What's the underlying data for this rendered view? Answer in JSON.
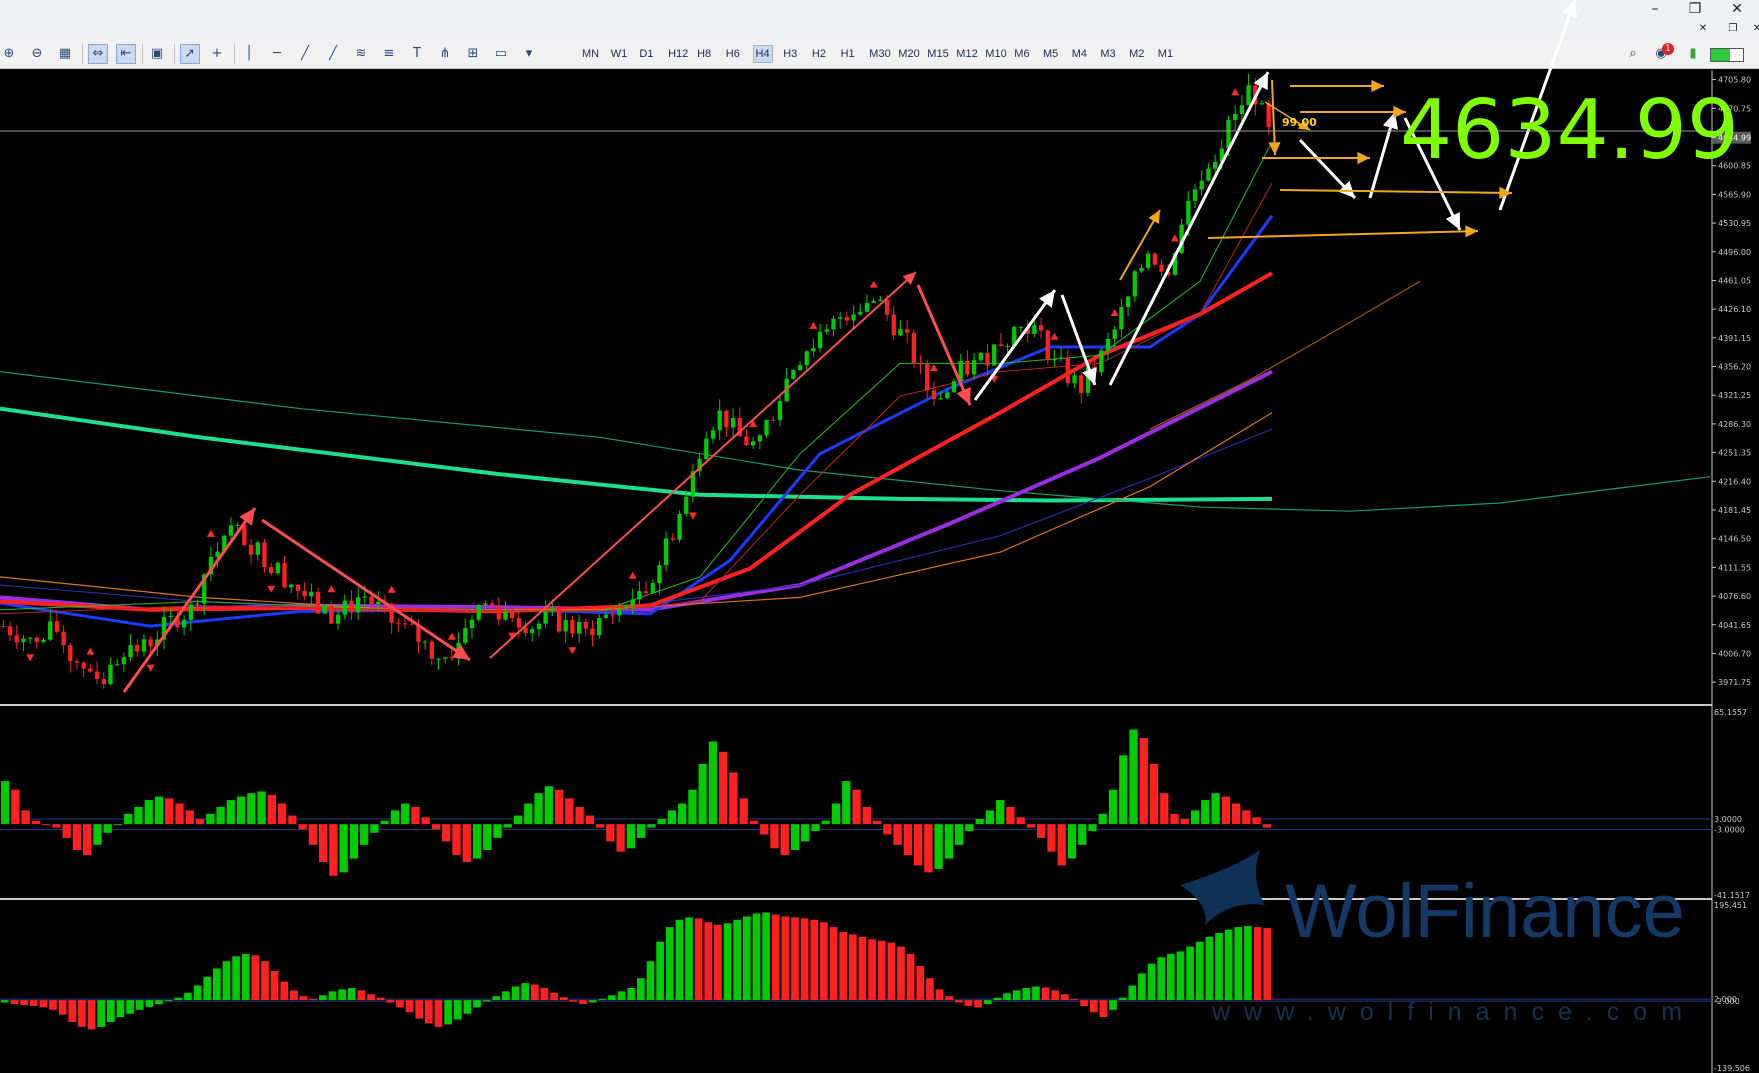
{
  "window": {
    "minimize": "–",
    "restore": "❐",
    "close": "✕"
  },
  "toolbar": {
    "timeframes": [
      "MN",
      "W1",
      "D1",
      "H12",
      "H8",
      "H6",
      "H4",
      "H3",
      "H2",
      "H1",
      "M30",
      "M20",
      "M15",
      "M12",
      "M10",
      "M6",
      "M5",
      "M4",
      "M3",
      "M2",
      "M1"
    ],
    "active_timeframe": "H4",
    "notification_badge": "1",
    "icons": [
      "zoom-in-icon",
      "zoom-out-icon",
      "grid-icon",
      "autoscroll-icon",
      "chart-shift-icon",
      "screenshot-icon",
      "cursor-icon",
      "crosshair-icon",
      "vertical-line-icon",
      "horizontal-line-icon",
      "trendline-icon",
      "ray-icon",
      "channel-icon",
      "fibonacci-icon",
      "text-icon",
      "andrews-icon",
      "gann-icon",
      "rectangle-icon",
      "shapes-icon"
    ]
  },
  "colors": {
    "background": "#000000",
    "bull": "#00cc00",
    "bear": "#ff2020",
    "price_label_big": "#7fff00",
    "ma_fast": "#ff2020",
    "ma_blue": "#1a3cff",
    "ma_purple": "#9a2fe0",
    "ma_green_long": "#1fe08a",
    "arrow_red": "#ff4c4c",
    "arrow_white": "#ffffff",
    "arrow_orange": "#f0a818",
    "watermark": "#123a66"
  },
  "chart_data": [
    {
      "type": "candlestick",
      "title": "",
      "current_price_label": "4634.99",
      "annotation_label": "99.00",
      "price_axis_ticks": [
        "4705.80",
        "4670.75",
        "4634.99",
        "4600.85",
        "4565.90",
        "4530.95",
        "4496.00",
        "4461.05",
        "4426.10",
        "4391.15",
        "4356.20",
        "4321.25",
        "4286.30",
        "4251.35",
        "4216.40",
        "4181.45",
        "4146.50",
        "4111.55",
        "4076.60",
        "4041.65",
        "4006.70",
        "3971.75"
      ],
      "ylim": [
        3950,
        4715
      ],
      "current_price": 4634.99,
      "close_path": [
        4040,
        4030,
        4015,
        4040,
        4000,
        3990,
        3975,
        4015,
        4010,
        4030,
        4050,
        4060,
        4120,
        4160,
        4150,
        4130,
        4110,
        4090,
        4070,
        4050,
        4060,
        4080,
        4060,
        4040,
        4030,
        4010,
        4000,
        4040,
        4070,
        4060,
        4050,
        4040,
        4050,
        4040,
        4030,
        4050,
        4060,
        4080,
        4100,
        4150,
        4200,
        4280,
        4300,
        4270,
        4260,
        4300,
        4350,
        4380,
        4390,
        4420,
        4430,
        4440,
        4410,
        4380,
        4330,
        4320,
        4350,
        4360,
        4380,
        4400,
        4410,
        4380,
        4350,
        4330,
        4360,
        4400,
        4450,
        4500,
        4470,
        4540,
        4590,
        4620,
        4660,
        4700,
        4640
      ],
      "annotations": [
        "4634.99",
        "99.00"
      ]
    },
    {
      "type": "bar",
      "title": "",
      "ylim": [
        -41.1517,
        65.1557
      ],
      "axis_ticks": [
        "65.1557",
        "3.0000",
        "-3.0000",
        "-41.1517"
      ],
      "levels": [
        3.0,
        -3.0
      ],
      "values": [
        25,
        20,
        8,
        2,
        0,
        -2,
        -8,
        -15,
        -18,
        -12,
        -5,
        0,
        6,
        10,
        14,
        16,
        15,
        12,
        8,
        3,
        6,
        10,
        14,
        16,
        18,
        19,
        17,
        12,
        5,
        -3,
        -12,
        -22,
        -30,
        -28,
        -20,
        -12,
        -5,
        2,
        8,
        12,
        10,
        4,
        -3,
        -10,
        -18,
        -22,
        -20,
        -15,
        -8,
        -2,
        5,
        12,
        18,
        22,
        20,
        15,
        10,
        5,
        -2,
        -10,
        -16,
        -14,
        -8,
        -2,
        3,
        8,
        12,
        20,
        35,
        48,
        42,
        30,
        15,
        2,
        -6,
        -14,
        -18,
        -15,
        -10,
        -4,
        2,
        12,
        25,
        20,
        10,
        2,
        -6,
        -12,
        -18,
        -24,
        -28,
        -26,
        -20,
        -12,
        -4,
        3,
        8,
        14,
        10,
        4,
        -2,
        -8,
        -16,
        -24,
        -20,
        -12,
        -4,
        6,
        20,
        40,
        55,
        50,
        35,
        18,
        6,
        3,
        8,
        14,
        18,
        16,
        12,
        8,
        4,
        -2
      ]
    },
    {
      "type": "bar",
      "title": "",
      "ylim": [
        -139.506,
        195.451
      ],
      "axis_ticks": [
        "195.451",
        "2.000",
        "-2.000",
        "-139.506"
      ],
      "levels": [
        2.0,
        -2.0
      ],
      "values": [
        -5,
        -8,
        -10,
        -12,
        -15,
        -20,
        -30,
        -45,
        -55,
        -60,
        -55,
        -45,
        -35,
        -28,
        -20,
        -14,
        -8,
        -2,
        5,
        15,
        30,
        48,
        65,
        80,
        90,
        95,
        92,
        80,
        60,
        38,
        20,
        8,
        2,
        10,
        18,
        22,
        25,
        20,
        12,
        5,
        -5,
        -15,
        -25,
        -38,
        -48,
        -55,
        -50,
        -40,
        -28,
        -15,
        -3,
        8,
        18,
        28,
        35,
        32,
        25,
        15,
        6,
        -3,
        -8,
        -5,
        2,
        10,
        18,
        25,
        45,
        80,
        120,
        150,
        165,
        170,
        168,
        160,
        155,
        158,
        165,
        172,
        178,
        180,
        176,
        172,
        170,
        168,
        165,
        160,
        150,
        140,
        135,
        130,
        125,
        122,
        118,
        110,
        95,
        70,
        45,
        22,
        8,
        -5,
        -12,
        -15,
        -8,
        5,
        14,
        20,
        25,
        28,
        26,
        20,
        12,
        2,
        -12,
        -25,
        -35,
        -20,
        5,
        30,
        55,
        75,
        88,
        95,
        100,
        110,
        120,
        130,
        138,
        145,
        150,
        152,
        150,
        148
      ]
    }
  ],
  "watermark": {
    "brand": "WolFinance",
    "url": "www.wolfinance.com"
  }
}
